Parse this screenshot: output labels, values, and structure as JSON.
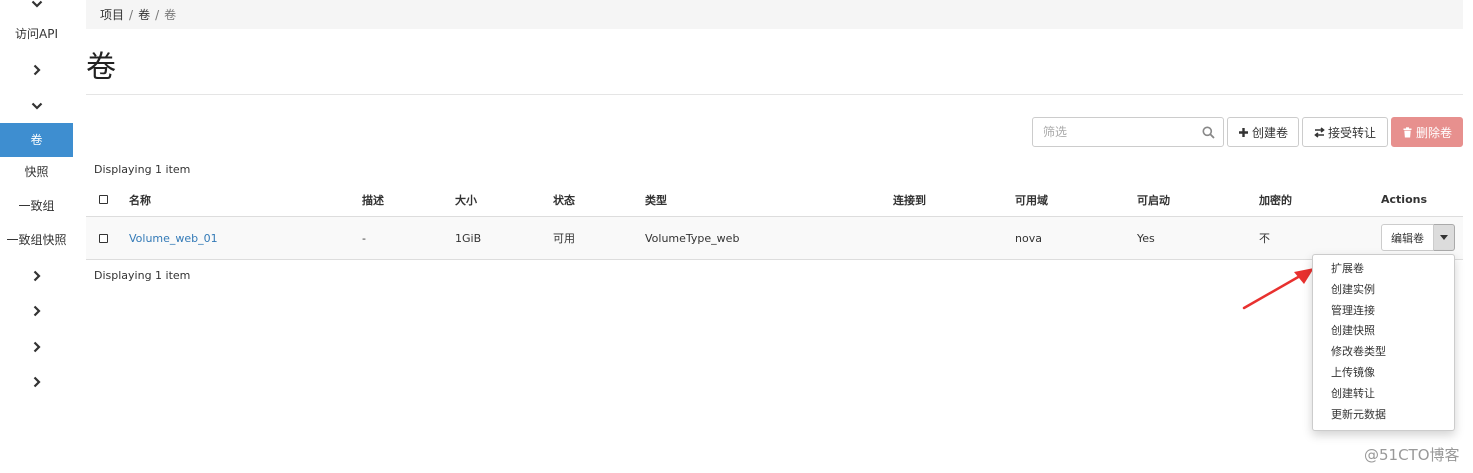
{
  "sidebar": {
    "access_api": "访问API",
    "active_item": "卷",
    "items": [
      "快照",
      "一致组",
      "一致组快照"
    ]
  },
  "breadcrumb": [
    "项目",
    "卷",
    "卷"
  ],
  "page_title": "卷",
  "toolbar": {
    "filter_placeholder": "筛选",
    "create_label": "创建卷",
    "accept_transfer_label": "接受转让",
    "delete_label": "删除卷"
  },
  "displaying_text": "Displaying 1 item",
  "table": {
    "headers": [
      "名称",
      "描述",
      "大小",
      "状态",
      "类型",
      "连接到",
      "可用域",
      "可启动",
      "加密的",
      "Actions"
    ],
    "rows": [
      {
        "name": "Volume_web_01",
        "description": "-",
        "size": "1GiB",
        "status": "可用",
        "type": "VolumeType_web",
        "attached_to": "",
        "zone": "nova",
        "bootable": "Yes",
        "encrypted": "不",
        "action_label": "编辑卷"
      }
    ]
  },
  "dropdown_items": [
    "扩展卷",
    "创建实例",
    "管理连接",
    "创建快照",
    "修改卷类型",
    "上传镜像",
    "创建转让",
    "更新元数据"
  ],
  "watermark": "@51CTO博客",
  "colors": {
    "active": "#3e8ed0",
    "link": "#337ab7",
    "danger": "#e7908e",
    "arrow": "#e8312f"
  }
}
